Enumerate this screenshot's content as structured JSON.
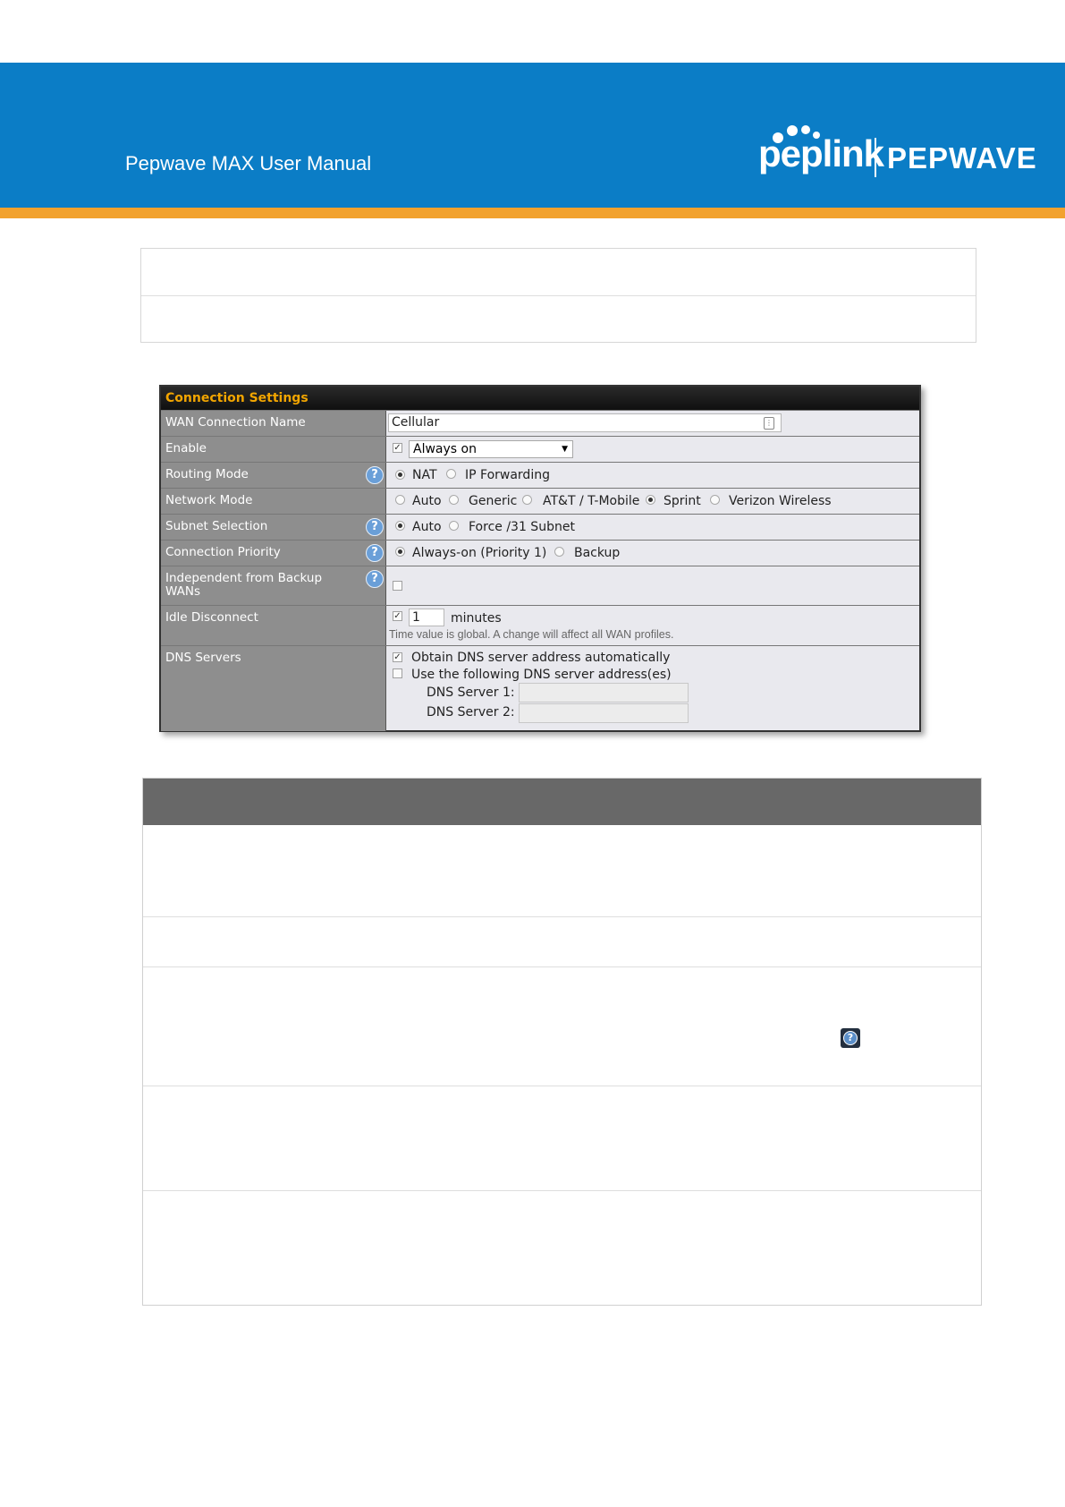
{
  "header": {
    "manual_title": "Pepwave MAX User Manual",
    "brand_left": "peplink",
    "brand_right": "PEPWAVE",
    "colors": {
      "banner": "#0b7dc6",
      "stripe": "#f2a22e"
    }
  },
  "panel": {
    "title": "Connection Settings",
    "wan_name": {
      "label": "WAN Connection Name",
      "value": "Cellular"
    },
    "enable": {
      "label": "Enable",
      "checked": true,
      "selected": "Always on"
    },
    "routing_mode": {
      "label": "Routing Mode",
      "options": [
        "NAT",
        "IP Forwarding"
      ],
      "selected": "NAT"
    },
    "network_mode": {
      "label": "Network Mode",
      "options": [
        "Auto",
        "Generic",
        "AT&T / T-Mobile",
        "Sprint",
        "Verizon Wireless"
      ],
      "selected": "Sprint"
    },
    "subnet_selection": {
      "label": "Subnet Selection",
      "options": [
        "Auto",
        "Force /31 Subnet"
      ],
      "selected": "Auto"
    },
    "connection_priority": {
      "label": "Connection Priority",
      "options": [
        "Always-on (Priority 1)",
        "Backup"
      ],
      "selected": "Always-on (Priority 1)"
    },
    "independent": {
      "label_line1": "Independent from Backup",
      "label_line2": "WANs",
      "checked": false
    },
    "idle_disconnect": {
      "label": "Idle Disconnect",
      "checked": true,
      "value": "1",
      "unit": "minutes",
      "note": "Time value is global. A change will affect all WAN profiles."
    },
    "dns": {
      "label": "DNS Servers",
      "auto_label": "Obtain DNS server address automatically",
      "auto_checked": true,
      "manual_label": "Use the following DNS server address(es)",
      "manual_checked": false,
      "server1_label": "DNS Server 1:",
      "server2_label": "DNS Server 2:"
    },
    "help_glyph": "?",
    "icons": {
      "help": "question-circle-icon",
      "password": "key-icon",
      "dropdown": "triangle-down-icon"
    }
  },
  "table_help_glyph": "?"
}
